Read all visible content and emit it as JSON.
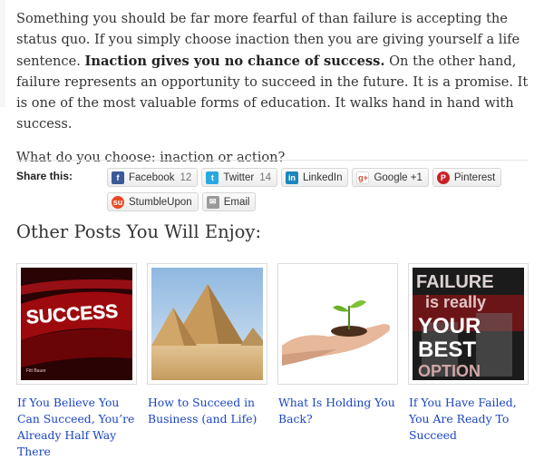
{
  "article": {
    "p1_start": "Something you should be far more fearful of than failure is accepting the status quo. If you simply choose inaction then you are giving yourself a life sentence. ",
    "p1_bold": "Inaction gives you no chance of success.",
    "p1_end": " On the other hand, failure represents an opportunity to succeed in the future. It is a promise. It is one of the most valuable forms of education. It walks hand in hand with success.",
    "p2": "What do you choose: inaction or action?"
  },
  "share": {
    "label": "Share this:",
    "buttons": [
      {
        "label": "Facebook",
        "count": "12",
        "icon": "facebook-icon",
        "color": "#3b5998"
      },
      {
        "label": "Twitter",
        "count": "14",
        "icon": "twitter-icon",
        "color": "#2aa9e0"
      },
      {
        "label": "LinkedIn",
        "icon": "linkedin-icon",
        "color": "#1b86bc"
      },
      {
        "label": "Google +1",
        "icon": "google-plus-icon",
        "color": "#dd4b39"
      },
      {
        "label": "Pinterest",
        "icon": "pinterest-icon",
        "color": "#cb2027"
      },
      {
        "label": "StumbleUpon",
        "icon": "stumbleupon-icon",
        "color": "#eb4924"
      },
      {
        "label": "Email",
        "icon": "email-icon",
        "color": "#888888"
      }
    ]
  },
  "related": {
    "heading": "Other Posts You Will Enjoy:",
    "posts": [
      {
        "title": "If You Believe You Can Succeed, You’re Already Half Way There",
        "thumb_text": "SUCCESS",
        "thumb_caption": "Fitt Bauer"
      },
      {
        "title": "How to Succeed in Business (and Life)"
      },
      {
        "title": "What Is Holding You Back?"
      },
      {
        "title": "If You Have Failed, You Are Ready To Succeed",
        "thumb_text": "FAILURE is really YOUR BEST OPTION"
      }
    ]
  },
  "colors": {
    "link": "#1a45c2",
    "text": "#333333"
  }
}
